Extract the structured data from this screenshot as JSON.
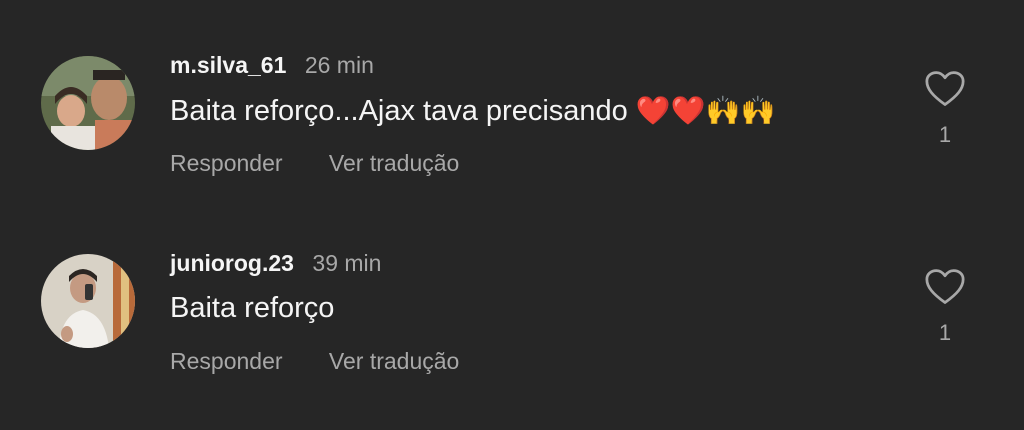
{
  "comments": [
    {
      "username": "m.silva_61",
      "time": "26 min",
      "text": "Baita reforço...Ajax tava precisando ",
      "emojis": "❤️❤️🙌🙌",
      "reply_label": "Responder",
      "translate_label": "Ver tradução",
      "like_count": "1",
      "avatar_icon": "avatar-photo"
    },
    {
      "username": "juniorog.23",
      "time": "39 min",
      "text": "Baita reforço",
      "emojis": "",
      "reply_label": "Responder",
      "translate_label": "Ver tradução",
      "like_count": "1",
      "avatar_icon": "avatar-photo"
    }
  ],
  "colors": {
    "background": "#262626",
    "primary_text": "#f5f5f5",
    "secondary_text": "#a8a8a8",
    "heart": "#ff3040"
  }
}
